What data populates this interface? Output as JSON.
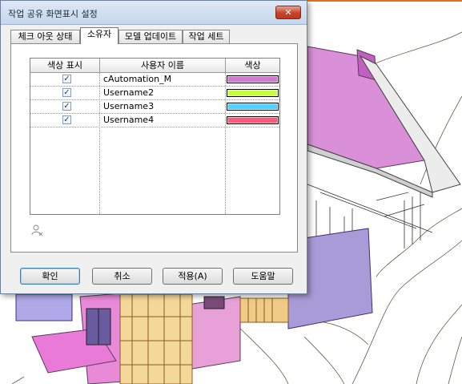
{
  "window": {
    "title": "작업 공유 화면표시 설정",
    "close_glyph": "✕"
  },
  "tabs": [
    {
      "label": "체크 아웃 상태",
      "active": false
    },
    {
      "label": "소유자",
      "active": true
    },
    {
      "label": "모델 업데이트",
      "active": false
    },
    {
      "label": "작업 세트",
      "active": false
    }
  ],
  "table": {
    "headers": [
      "색상 표시",
      "사용자 이름",
      "색상"
    ],
    "rows": [
      {
        "checked": true,
        "name": "cAutomation_M",
        "color": "#d27ad2"
      },
      {
        "checked": true,
        "name": "Username2",
        "color": "#c7ff3c"
      },
      {
        "checked": true,
        "name": "Username3",
        "color": "#4fd2ff"
      },
      {
        "checked": true,
        "name": "Username4",
        "color": "#ff5a7a"
      }
    ],
    "check_glyph": "✓"
  },
  "footer_icon": "user-remove-icon",
  "buttons": {
    "ok": "확인",
    "cancel": "취소",
    "apply": "적용(A)",
    "help": "도움말"
  },
  "colors": {
    "scene_magenta": "#d990d9",
    "scene_purple": "#9f8fd0",
    "scene_wood": "#e8b86a"
  }
}
